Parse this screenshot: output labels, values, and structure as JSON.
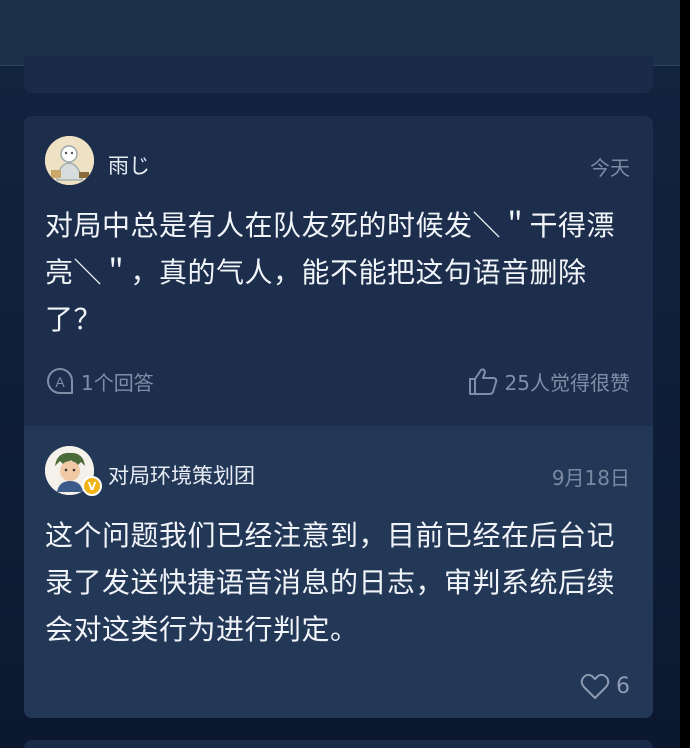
{
  "question": {
    "author": "雨じ",
    "date": "今天",
    "text": "对局中总是有人在队友死的时候发＼＂干得漂亮＼＂，真的气人，能不能把这句语音删除了？",
    "answers_count": "1个回答",
    "agree_count": "25人觉得很赞"
  },
  "answer": {
    "author": "对局环境策划团",
    "date": "9月18日",
    "text": "这个问题我们已经注意到，目前已经在后台记录了发送快捷语音消息的日志，审判系统后续会对这类行为进行判定。",
    "likes": "6",
    "verified_badge": "V"
  },
  "colors": {
    "background": "#0f1e37",
    "card": "#1c2e4b",
    "answer_panel": "#233756",
    "muted_text": "#7f8ea6",
    "badge": "#f2b315"
  },
  "icons": {
    "answers": "answer-a-icon",
    "agree": "thumbs-up-icon",
    "like": "heart-icon"
  }
}
